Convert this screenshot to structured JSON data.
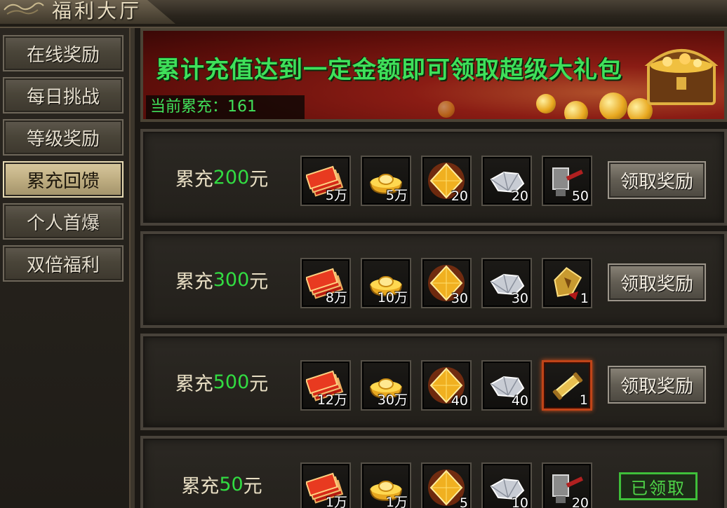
{
  "window": {
    "title": "福利大厅"
  },
  "sidebar": {
    "items": [
      {
        "label": "在线奖励",
        "active": false
      },
      {
        "label": "每日挑战",
        "active": false
      },
      {
        "label": "等级奖励",
        "active": false
      },
      {
        "label": "累充回馈",
        "active": true
      },
      {
        "label": "个人首爆",
        "active": false
      },
      {
        "label": "双倍福利",
        "active": false
      }
    ]
  },
  "banner": {
    "headline": "累计充值达到一定金额即可领取超级大礼包",
    "current_label": "当前累充：",
    "current_value": "161"
  },
  "rows": [
    {
      "prefix": "累充",
      "amount": "200",
      "suffix": "元",
      "items": [
        {
          "icon": "red-ticket-bundle-icon",
          "count": "5万"
        },
        {
          "icon": "gold-ingot-icon",
          "count": "5万"
        },
        {
          "icon": "gold-gem-icon",
          "count": "20"
        },
        {
          "icon": "silver-crystal-icon",
          "count": "20"
        },
        {
          "icon": "forge-hammer-icon",
          "count": "50"
        }
      ],
      "action": "领取奖励",
      "claimed": false
    },
    {
      "prefix": "累充",
      "amount": "300",
      "suffix": "元",
      "items": [
        {
          "icon": "red-ticket-bundle-icon",
          "count": "8万"
        },
        {
          "icon": "gold-ingot-icon",
          "count": "10万"
        },
        {
          "icon": "gold-gem-icon",
          "count": "30"
        },
        {
          "icon": "silver-crystal-icon",
          "count": "30"
        },
        {
          "icon": "golden-shield-token-icon",
          "count": "1"
        }
      ],
      "action": "领取奖励",
      "claimed": false
    },
    {
      "prefix": "累充",
      "amount": "500",
      "suffix": "元",
      "items": [
        {
          "icon": "red-ticket-bundle-icon",
          "count": "12万"
        },
        {
          "icon": "gold-ingot-icon",
          "count": "30万"
        },
        {
          "icon": "gold-gem-icon",
          "count": "40"
        },
        {
          "icon": "silver-crystal-icon",
          "count": "40"
        },
        {
          "icon": "golden-scroll-icon",
          "count": "1",
          "special": true
        }
      ],
      "action": "领取奖励",
      "claimed": false
    },
    {
      "prefix": "累充",
      "amount": "50",
      "suffix": "元",
      "items": [
        {
          "icon": "red-ticket-bundle-icon",
          "count": "1万"
        },
        {
          "icon": "gold-ingot-icon",
          "count": "1万"
        },
        {
          "icon": "gold-gem-icon",
          "count": "5"
        },
        {
          "icon": "silver-crystal-icon",
          "count": "10"
        },
        {
          "icon": "forge-hammer-icon",
          "count": "20"
        }
      ],
      "action": "已领取",
      "claimed": true
    }
  ],
  "colors": {
    "accent_green": "#32dc42",
    "active_tab": "#bfae82",
    "banner_red": "#8a1c14"
  }
}
